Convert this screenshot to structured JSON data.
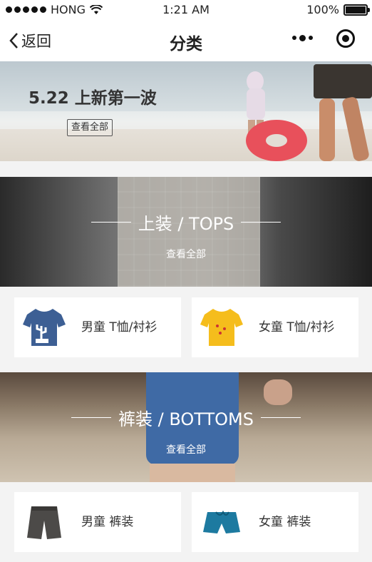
{
  "status_bar": {
    "carrier": "HONG",
    "time": "1:21 AM",
    "battery": "100%"
  },
  "nav": {
    "back_label": "返回",
    "title": "分类"
  },
  "banner": {
    "title": "5.22 上新第一波",
    "button": "查看全部"
  },
  "sections": [
    {
      "heading": "上装 / TOPS",
      "link": "查看全部",
      "items": [
        {
          "label": "男童 T恤/衬衫",
          "icon": "blue-tshirt"
        },
        {
          "label": "女童 T恤/衬衫",
          "icon": "yellow-tshirt"
        }
      ]
    },
    {
      "heading": "裤装 / BOTTOMS",
      "link": "查看全部",
      "items": [
        {
          "label": "男童 裤装",
          "icon": "gray-shorts"
        },
        {
          "label": "女童 裤装",
          "icon": "teal-shorts"
        }
      ]
    }
  ],
  "colors": {
    "background": "#f3f3f3",
    "card": "#ffffff",
    "text": "#333333"
  }
}
